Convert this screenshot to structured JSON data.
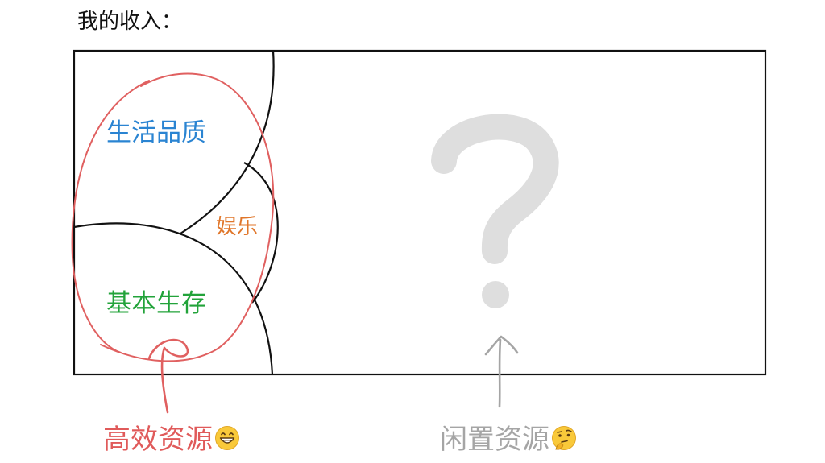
{
  "title": "我的收入：",
  "colors": {
    "outline": "#111111",
    "efficient_accent": "#e05a5a",
    "idle_accent": "#a5a5a5",
    "question_mark": "#dedede",
    "quality_text": "#2a84d2",
    "fun_text": "#e0762a",
    "basic_text": "#22a33a"
  },
  "regions": {
    "quality": "生活品质",
    "fun": "娱乐",
    "basic": "基本生存",
    "unknown": "?"
  },
  "callouts": {
    "efficient": {
      "label": "高效资源",
      "emoji": "grinning-face-icon"
    },
    "idle": {
      "label": "闲置资源",
      "emoji": "thinking-face-icon"
    }
  }
}
